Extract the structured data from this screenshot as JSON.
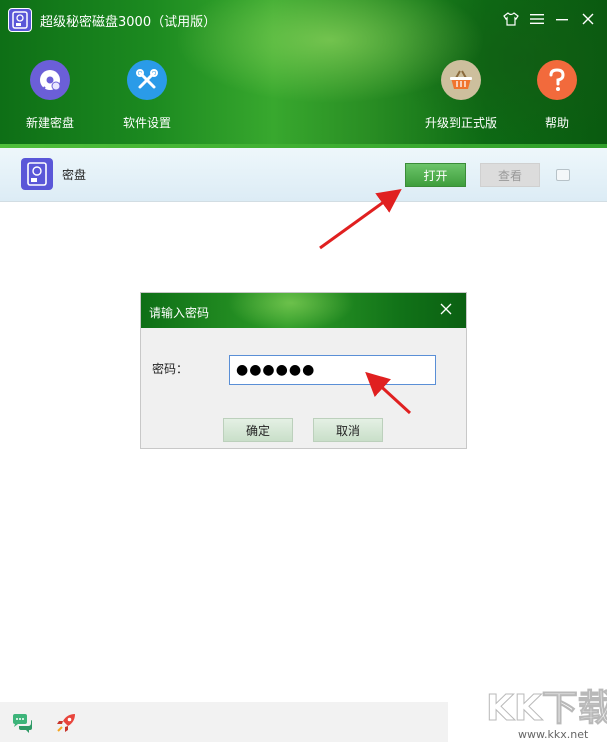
{
  "window": {
    "title": "超级秘密磁盘3000（试用版）",
    "controls": [
      "skin-icon",
      "menu-icon",
      "minimize-icon",
      "close-icon"
    ]
  },
  "toolbar": {
    "items": [
      {
        "label": "新建密盘",
        "icon": "new-disk-icon",
        "color": "#6b5fd8"
      },
      {
        "label": "软件设置",
        "icon": "tools-icon",
        "color": "#2a9be8"
      },
      {
        "label": "升级到正式版",
        "icon": "basket-icon",
        "color": "#cdbf9d"
      },
      {
        "label": "帮助",
        "icon": "help-icon",
        "color": "#f26a3c"
      }
    ]
  },
  "disk": {
    "name": "密盘",
    "open_label": "打开",
    "view_label": "查看"
  },
  "dialog": {
    "title": "请输入密码",
    "password_label": "密码：",
    "password_value": "●●●●●●",
    "ok_label": "确定",
    "cancel_label": "取消"
  },
  "bottom": {
    "icons": [
      "chat-icon",
      "rocket-icon"
    ]
  },
  "watermark": {
    "text": "KK下载",
    "url": "www.kkx.net"
  },
  "colors": {
    "header_green": "#1c8a20",
    "open_button": "#4fae4d",
    "arrow_red": "#e02020",
    "disk_purple": "#5a57d8"
  }
}
